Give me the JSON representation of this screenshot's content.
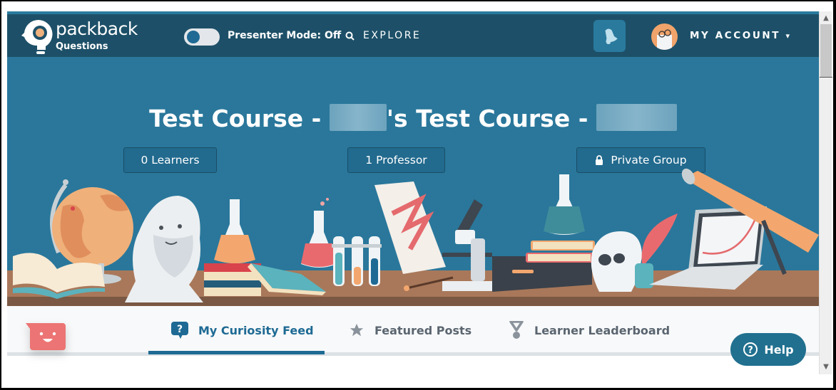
{
  "header": {
    "brand_name": "packback",
    "brand_sub": "Questions",
    "presenter_mode_label": "Presenter Mode: Off",
    "presenter_mode_on": false,
    "explore_label": "EXPLORE",
    "account_label": "MY ACCOUNT",
    "account_caret": "▾"
  },
  "banner": {
    "title_part1": "Test Course - ",
    "title_part2": "'s Test Course - ",
    "stats": {
      "learners": "0 Learners",
      "professors": "1 Professor",
      "privacy": "Private Group"
    }
  },
  "tabs": [
    {
      "label": "My Curiosity Feed",
      "icon": "question-bubble-icon",
      "active": true
    },
    {
      "label": "Featured Posts",
      "icon": "star-icon",
      "active": false
    },
    {
      "label": "Learner Leaderboard",
      "icon": "medal-icon",
      "active": false
    }
  ],
  "help": {
    "label": "Help"
  },
  "colors": {
    "header_bg": "#1d5068",
    "banner_bg": "#2a779b",
    "accent": "#1e6a94",
    "mascot": "#ec7474"
  }
}
